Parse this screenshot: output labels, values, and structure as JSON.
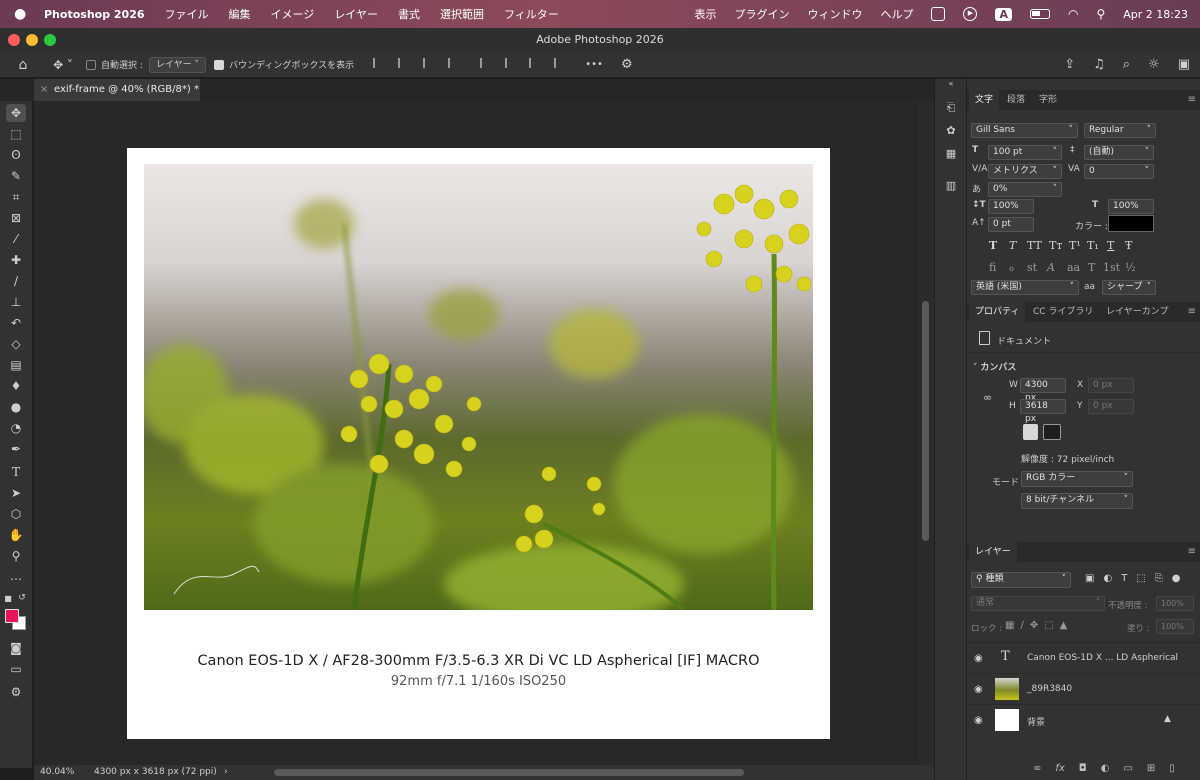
{
  "menubar": {
    "app_name": "Photoshop 2026",
    "menus": [
      "ファイル",
      "編集",
      "イメージ",
      "レイヤー",
      "書式",
      "選択範囲",
      "フィルター"
    ],
    "right_menus": [
      "表示",
      "プラグイン",
      "ウィンドウ",
      "ヘルプ"
    ],
    "input_source": "A",
    "date_time": "Apr 2  18:23"
  },
  "window": {
    "title": "Adobe Photoshop 2026"
  },
  "options": {
    "auto_select_label": "自動選択 :",
    "auto_select_value": "レイヤー",
    "bounding_box_label": "バウンディングボックスを表示",
    "more": "•••"
  },
  "document_tab": {
    "title": "exif-frame @ 40% (RGB/8*) *",
    "close": "×"
  },
  "document": {
    "caption_main": "Canon EOS-1D X  /  AF28-300mm F/3.5-6.3 XR Di VC LD Aspherical [IF] MACRO",
    "caption_sub": "92mm f/7.1 1/160s ISO250",
    "accent_flower": "#d7d21e"
  },
  "status": {
    "zoom": "40.04%",
    "doc_info": "4300 px x 3618 px (72 ppi)",
    "arrow": "›"
  },
  "character_panel": {
    "tabs": [
      "文字",
      "段落",
      "字形"
    ],
    "font_family": "Gill Sans",
    "font_style": "Regular",
    "size": "100 pt",
    "leading": "(自動)",
    "kerning": "メトリクス",
    "tracking": "0",
    "tsume": "0%",
    "vscale": "100%",
    "hscale": "100%",
    "baseline": "0 pt",
    "color_label": "カラー :",
    "text_color": "#000000",
    "style_glyphs": [
      "T",
      "T",
      "TT",
      "Tт",
      "T¹",
      "T₁",
      "T",
      "Ŧ"
    ],
    "opentype_glyphs": [
      "fi",
      "ℴ",
      "st",
      "A",
      "aa",
      "T",
      "1st",
      "½"
    ],
    "language": "英語 (米国)",
    "aa_label": "aa",
    "antialias": "シャープ"
  },
  "properties_panel": {
    "tabs": [
      "プロパティ",
      "CC ライブラリ",
      "レイヤーカンプ"
    ],
    "type_label": "ドキュメント",
    "section": "カンバス",
    "w_label": "W",
    "w_value": "4300 px",
    "h_label": "H",
    "h_value": "3618 px",
    "x_label": "X",
    "x_placeholder": "0 px",
    "y_label": "Y",
    "y_placeholder": "0 px",
    "resolution": "解像度 : 72 pixel/inch",
    "mode_label": "モード",
    "mode_value": "RGB カラー",
    "depth_value": "8 bit/チャンネル"
  },
  "layers_panel": {
    "tab": "レイヤー",
    "filter_label": "種類",
    "blend_mode": "通常",
    "opacity_label": "不透明度 :",
    "opacity": "100%",
    "lock_label": "ロック :",
    "fill_label": "塗り :",
    "fill": "100%",
    "layers": [
      {
        "name": "Canon EOS-1D X ... LD Aspherical",
        "kind": "text"
      },
      {
        "name": "_89R3840",
        "kind": "image"
      },
      {
        "name": "背景",
        "kind": "background"
      }
    ],
    "footer_icons": [
      "link-icon",
      "fx-icon",
      "mask-icon",
      "adjustment-icon",
      "group-icon",
      "new-layer-icon",
      "trash-icon"
    ]
  },
  "colors": {
    "foreground": "#e8155a",
    "background": "#ffffff"
  }
}
